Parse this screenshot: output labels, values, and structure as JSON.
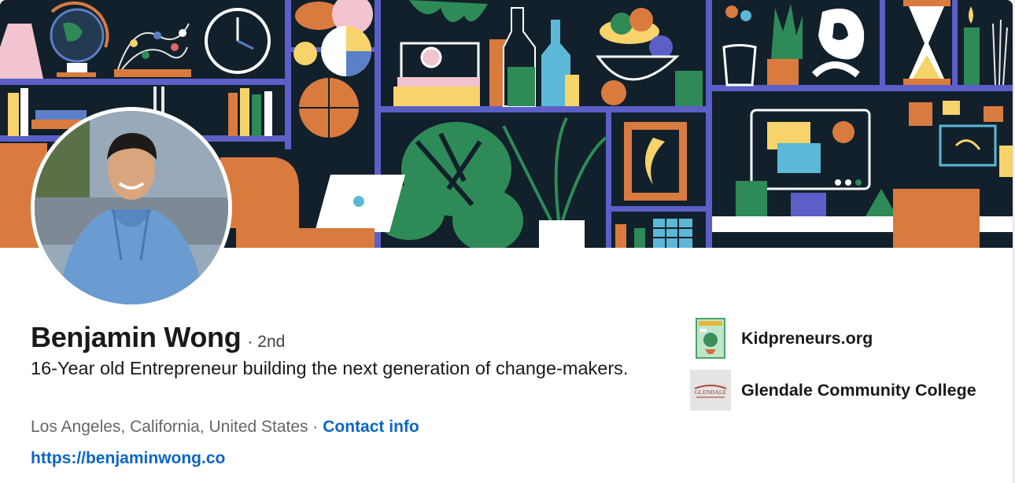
{
  "profile": {
    "name": "Benjamin Wong",
    "degree": "· 2nd",
    "headline": "16-Year old Entrepreneur building the next generation of change-makers.",
    "location": "Los Angeles, California, United States",
    "separator": "·",
    "contact_label": "Contact info",
    "website": "https://benjaminwong.co"
  },
  "organizations": [
    {
      "name": "Kidpreneurs.org",
      "logo_icon": "kidpreneurs-book-logo"
    },
    {
      "name": "Glendale Community College",
      "logo_icon": "glendale-college-logo",
      "logo_text": "GLENDALE"
    }
  ],
  "colors": {
    "link": "#0a66c2",
    "banner_bg": "#12202b",
    "shelf": "#5b5fc7",
    "orange": "#d97b3f",
    "green": "#2e8b57"
  }
}
